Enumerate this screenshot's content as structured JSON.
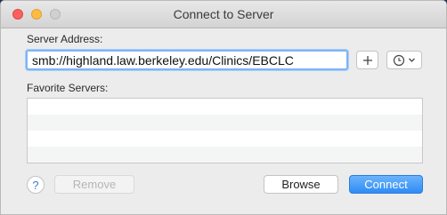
{
  "window": {
    "title": "Connect to Server"
  },
  "server_address": {
    "label": "Server Address:",
    "value": "smb://highland.law.berkeley.edu/Clinics/EBCLC"
  },
  "toolbar": {
    "add_icon": "plus-icon",
    "recent_icon": "clock-icon"
  },
  "favorites": {
    "label": "Favorite Servers:",
    "items": []
  },
  "buttons": {
    "help": "?",
    "remove": "Remove",
    "browse": "Browse",
    "connect": "Connect"
  },
  "colors": {
    "accent": "#2e8cf6",
    "focus_ring": "#7eb4f7",
    "close": "#fc605c",
    "minimize": "#fdbc40"
  }
}
